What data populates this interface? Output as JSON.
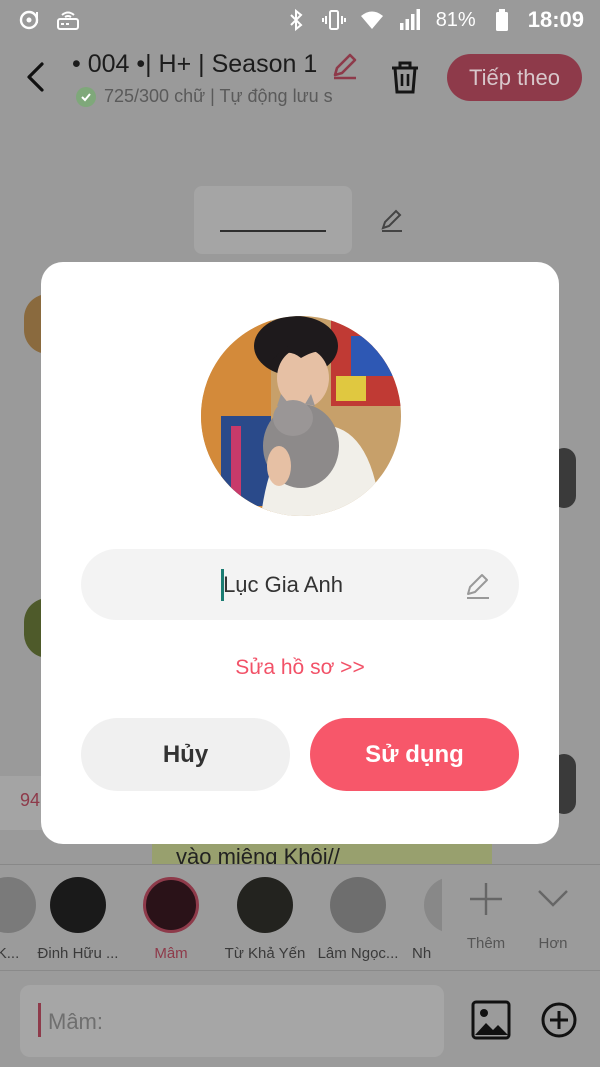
{
  "status_bar": {
    "battery": "81%",
    "time": "18:09"
  },
  "header": {
    "title": "• 004 •| H+ | Season 1",
    "word_count": "725/300 chữ | Tự động lưu s",
    "next_label": "Tiếp theo"
  },
  "chat": {
    "left_card_text": "94",
    "message_fragment": "vào miệng Khôi//"
  },
  "character_bar": {
    "characters": [
      {
        "name": "K..."
      },
      {
        "name": "Đinh Hữu ..."
      },
      {
        "name": "Mâm"
      },
      {
        "name": "Từ Khả Yến"
      },
      {
        "name": "Lâm Ngọc..."
      },
      {
        "name": "Nh"
      }
    ],
    "add_label": "Thêm",
    "more_label": "Hơn"
  },
  "composer": {
    "placeholder": "Mâm:"
  },
  "dialog": {
    "name_value": "Lục Gia Anh",
    "edit_profile_label": "Sửa hồ sơ >>",
    "cancel_label": "Hủy",
    "use_label": "Sử dụng"
  },
  "colors": {
    "accent": "#f7576a",
    "accent_dimmed": "#8e3a4a",
    "overlay_bg": "#9a9a9a"
  }
}
